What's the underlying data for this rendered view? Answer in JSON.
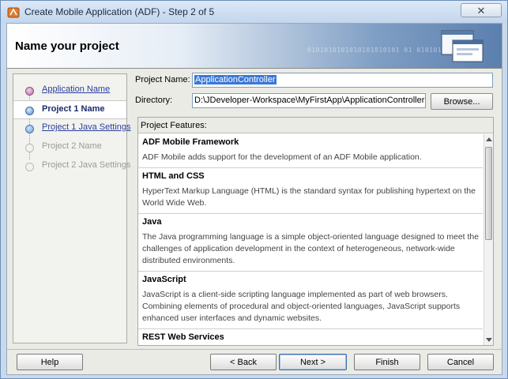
{
  "window": {
    "title": "Create Mobile Application (ADF) - Step 2 of 5",
    "close_label": "✕"
  },
  "header": {
    "title": "Name your project",
    "binary_text": "0101010101010101010101 01 0101010101"
  },
  "nav": {
    "items": [
      {
        "label": "Application Name",
        "state": "link"
      },
      {
        "label": "Project 1 Name",
        "state": "current"
      },
      {
        "label": "Project 1 Java Settings",
        "state": "next"
      },
      {
        "label": "Project 2 Name",
        "state": "disabled"
      },
      {
        "label": "Project 2 Java Settings",
        "state": "disabled"
      }
    ]
  },
  "form": {
    "project_name_label": "Project Name:",
    "project_name_value": "ApplicationController",
    "directory_label": "Directory:",
    "directory_value": "D:\\JDeveloper-Workspace\\MyFirstApp\\ApplicationController",
    "browse_label": "Browse..."
  },
  "features": {
    "title": "Project Features:",
    "items": [
      {
        "name": "ADF Mobile Framework",
        "desc": "ADF Mobile adds support for the development of an ADF Mobile application."
      },
      {
        "name": "HTML and CSS",
        "desc": "HyperText Markup Language (HTML) is the standard syntax for publishing hypertext on the World Wide Web."
      },
      {
        "name": "Java",
        "desc": "The Java programming language is a simple object-oriented language designed to meet the challenges of application development in the context of heterogeneous, network-wide distributed environments."
      },
      {
        "name": "JavaScript",
        "desc": "JavaScript is a client-side scripting language implemented as part of web browsers. Combining elements of procedural and object-oriented languages, JavaScript supports enhanced user interfaces and dynamic websites."
      },
      {
        "name": "REST Web Services",
        "desc": ""
      }
    ]
  },
  "buttons": {
    "help": "Help",
    "back": "< Back",
    "next": "Next >",
    "finish": "Finish",
    "cancel": "Cancel"
  }
}
